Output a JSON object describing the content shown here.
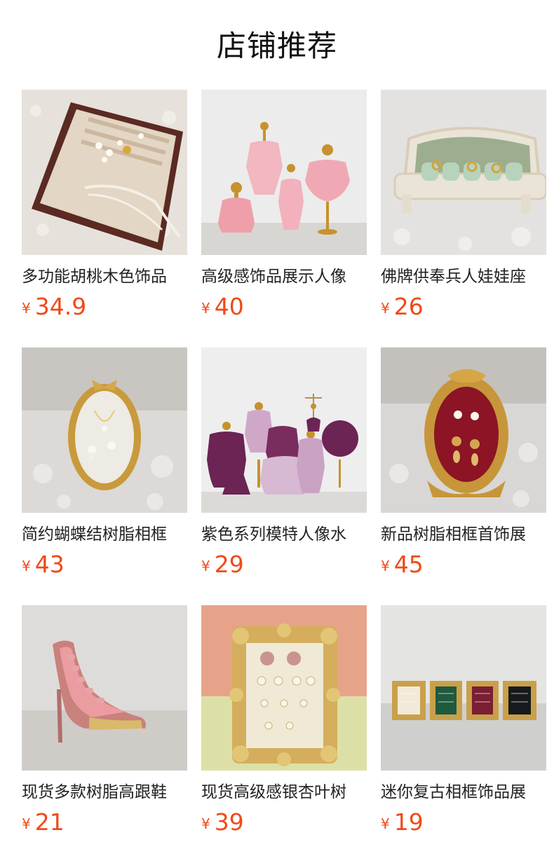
{
  "header": {
    "title": "店铺推荐"
  },
  "theme": {
    "price_color": "#f04a18",
    "text_color": "#222222"
  },
  "products": [
    {
      "name": "多功能胡桃木色饰品",
      "currency": "¥",
      "price": "34.9",
      "image": "walnut-jewelry-tray-image"
    },
    {
      "name": "高级感饰品展示人像",
      "currency": "¥",
      "price": "40",
      "image": "pink-mannequin-busts-image"
    },
    {
      "name": "佛牌供奉兵人娃娃座",
      "currency": "¥",
      "price": "26",
      "image": "green-sofa-ring-holder-image"
    },
    {
      "name": "简约蝴蝶结树脂相框",
      "currency": "¥",
      "price": "43",
      "image": "bow-oval-frame-image"
    },
    {
      "name": "紫色系列模特人像水",
      "currency": "¥",
      "price": "29",
      "image": "purple-mannequin-set-image"
    },
    {
      "name": "新品树脂相框首饰展",
      "currency": "¥",
      "price": "45",
      "image": "red-oval-frame-image"
    },
    {
      "name": "现货多款树脂高跟鞋",
      "currency": "¥",
      "price": "21",
      "image": "high-heel-ring-holder-image"
    },
    {
      "name": "现货高级感银杏叶树",
      "currency": "¥",
      "price": "39",
      "image": "ginkgo-frame-earring-image"
    },
    {
      "name": "迷你复古相框饰品展",
      "currency": "¥",
      "price": "19",
      "image": "mini-vintage-frames-image"
    }
  ]
}
